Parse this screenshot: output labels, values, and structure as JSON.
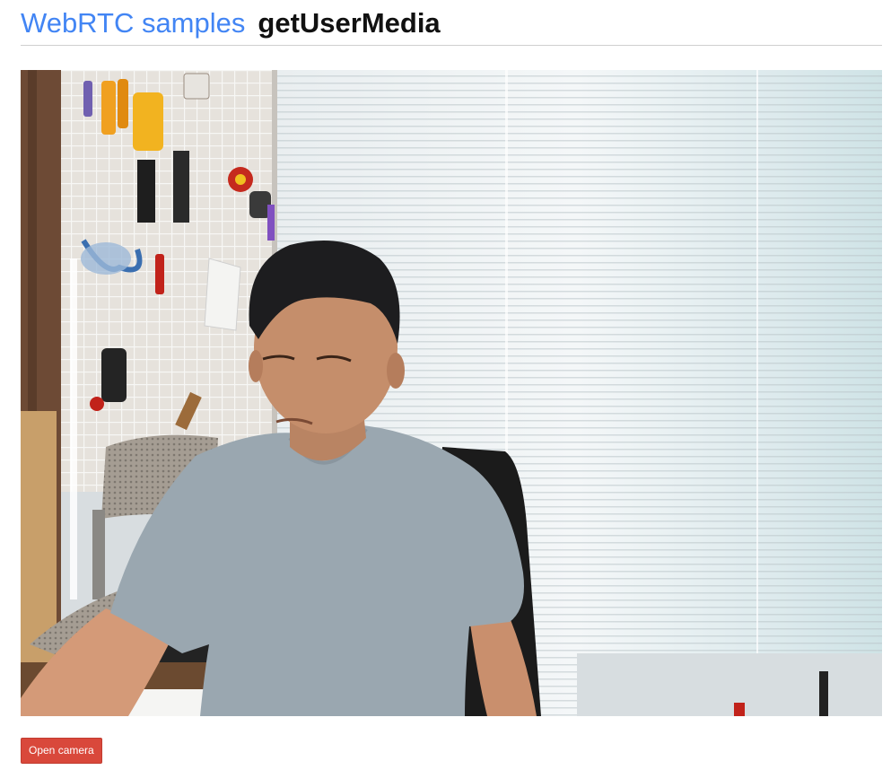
{
  "header": {
    "site_link_label": "WebRTC samples",
    "page_title": "getUserMedia"
  },
  "video": {
    "subject": "live-camera-feed-person-in-grey-tshirt",
    "accent_color": "#4285f4"
  },
  "controls": {
    "open_camera_label": "Open camera",
    "button_color": "#d9483b"
  }
}
